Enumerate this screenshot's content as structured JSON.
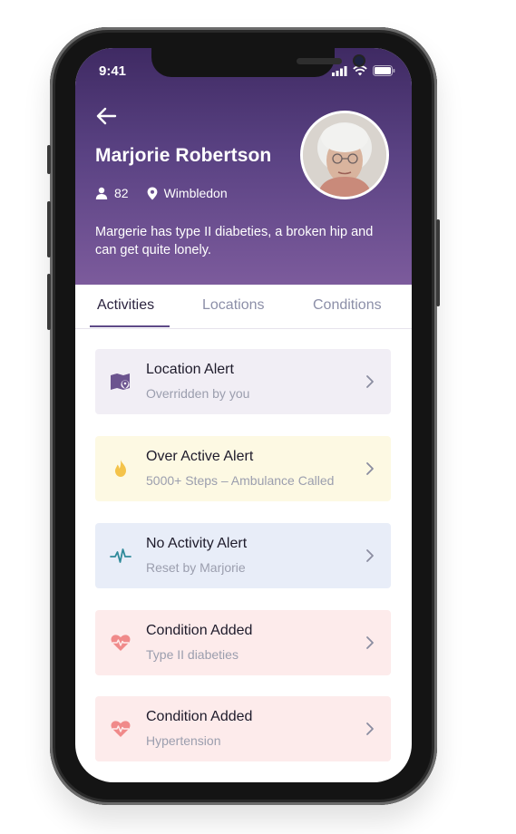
{
  "status_bar": {
    "time": "9:41"
  },
  "profile": {
    "name": "Marjorie Robertson",
    "age": "82",
    "location": "Wimbledon",
    "description": "Margerie has type II diabeties, a broken hip and can get quite lonely."
  },
  "tabs": [
    {
      "label": "Activities",
      "active": true
    },
    {
      "label": "Locations",
      "active": false
    },
    {
      "label": "Conditions",
      "active": false
    }
  ],
  "activities": [
    {
      "title": "Location Alert",
      "subtitle": "Overridden by you",
      "icon": "map-pin-icon",
      "bg": "#f1eef5",
      "icon_color": "#6c548f"
    },
    {
      "title": "Over Active Alert",
      "subtitle": "5000+ Steps – Ambulance Called",
      "icon": "flame-icon",
      "bg": "#fdf9e3",
      "icon_color": "#f4c34a"
    },
    {
      "title": "No Activity Alert",
      "subtitle": "Reset by Marjorie",
      "icon": "pulse-icon",
      "bg": "#e8edf8",
      "icon_color": "#2f8a9a"
    },
    {
      "title": "Condition Added",
      "subtitle": "Type II diabeties",
      "icon": "heart-pulse-icon",
      "bg": "#fdebeb",
      "icon_color": "#f08a8a"
    },
    {
      "title": "Condition Added",
      "subtitle": "Hypertension",
      "icon": "heart-pulse-icon",
      "bg": "#fdebeb",
      "icon_color": "#f08a8a"
    }
  ],
  "colors": {
    "header_top": "#3f2a63",
    "header_bottom": "#7c5b9c",
    "tab_active": "#5e4a88"
  }
}
